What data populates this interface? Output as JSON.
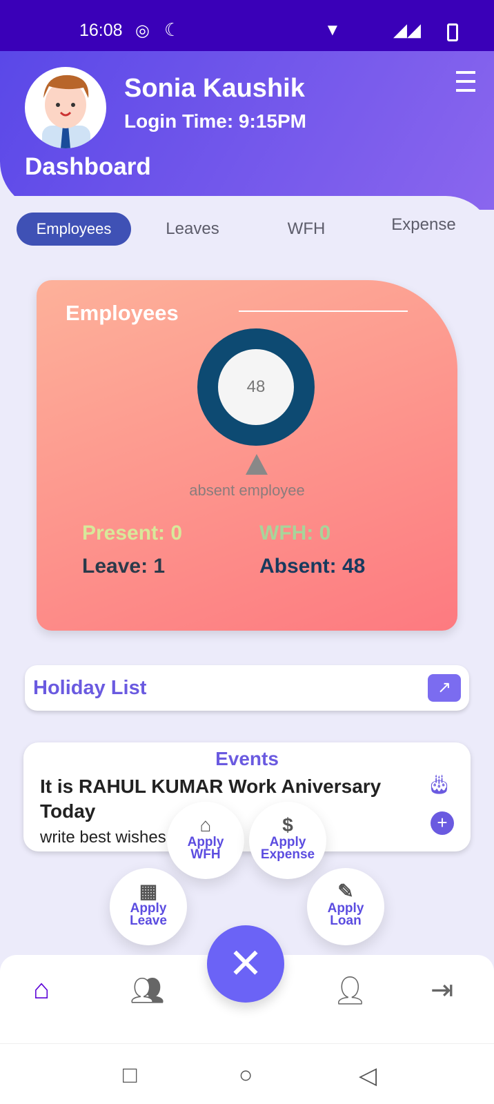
{
  "status_bar": {
    "time": "16:08"
  },
  "header": {
    "name": "Sonia Kaushik",
    "login_time": "Login Time: 9:15PM",
    "title": "Dashboard"
  },
  "tabs": [
    {
      "label": "Employees",
      "active": true
    },
    {
      "label": "Leaves"
    },
    {
      "label": "WFH"
    },
    {
      "label": "Expense"
    }
  ],
  "employees_card": {
    "title": "Employees",
    "total": "48",
    "indicator_label": "absent employee",
    "present": "Present: 0",
    "wfh": "WFH: 0",
    "leave": "Leave: 1",
    "absent": "Absent: 48",
    "colors": {
      "present": "#d8e89a",
      "wfh": "#a8d49a",
      "leave": "#2a3a4a",
      "absent": "#173a5e",
      "donut": "#0d4a72"
    }
  },
  "holiday": {
    "label": "Holiday List"
  },
  "events": {
    "title": "Events",
    "message": "It is RAHUL KUMAR Work Aniversary Today",
    "subtext": "write best wishes"
  },
  "quick_actions": [
    {
      "label1": "Apply",
      "label2": "WFH",
      "icon": "home-user-icon"
    },
    {
      "label1": "Apply",
      "label2": "Expense",
      "icon": "expense-doc-icon"
    },
    {
      "label1": "Apply",
      "label2": "Leave",
      "icon": "calendar-clock-icon"
    },
    {
      "label1": "Apply",
      "label2": "Loan",
      "icon": "loan-doc-icon"
    }
  ],
  "bottom_nav": [
    "home",
    "team",
    "profile",
    "logout"
  ],
  "accent": "#6b63f6"
}
